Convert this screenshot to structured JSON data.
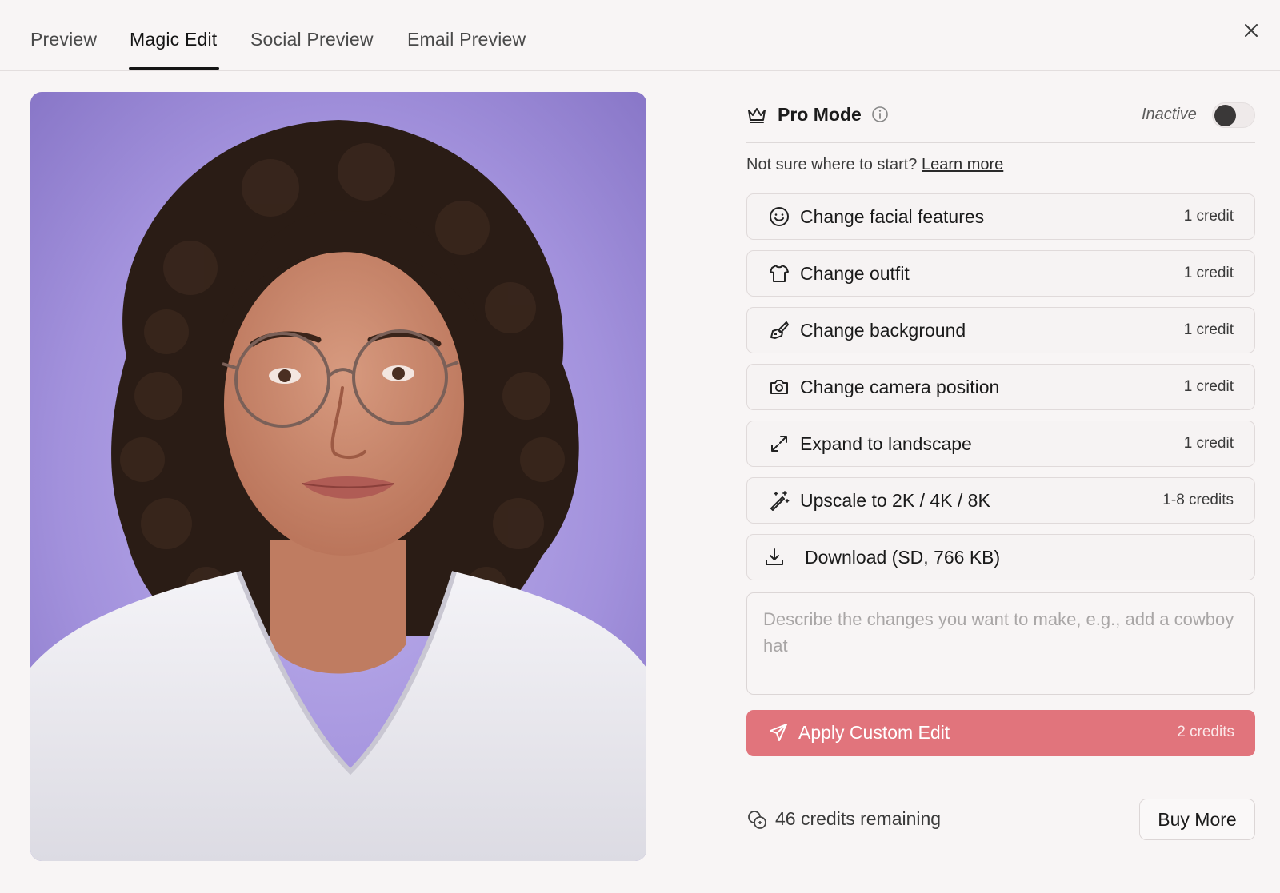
{
  "tabs": [
    {
      "label": "Preview",
      "active": false
    },
    {
      "label": "Magic Edit",
      "active": true
    },
    {
      "label": "Social Preview",
      "active": false
    },
    {
      "label": "Email Preview",
      "active": false
    }
  ],
  "pro_mode": {
    "label": "Pro Mode",
    "status": "Inactive",
    "enabled": false
  },
  "hint": {
    "text": "Not sure where to start?",
    "link": "Learn more"
  },
  "options": [
    {
      "icon": "smile-icon",
      "label": "Change facial features",
      "cost": "1 credit"
    },
    {
      "icon": "shirt-icon",
      "label": "Change outfit",
      "cost": "1 credit"
    },
    {
      "icon": "paintbrush-icon",
      "label": "Change background",
      "cost": "1 credit"
    },
    {
      "icon": "camera-icon",
      "label": "Change camera position",
      "cost": "1 credit"
    },
    {
      "icon": "expand-icon",
      "label": "Expand to landscape",
      "cost": "1 credit"
    },
    {
      "icon": "magic-wand-icon",
      "label": "Upscale to 2K / 4K / 8K",
      "cost": "1-8 credits"
    },
    {
      "icon": "download-icon",
      "label": "Download (SD, 766 KB)",
      "cost": ""
    }
  ],
  "prompt": {
    "placeholder": "Describe the changes you want to make, e.g., add a cowboy hat",
    "value": ""
  },
  "apply": {
    "label": "Apply Custom Edit",
    "cost": "2 credits"
  },
  "credits": {
    "remaining": "46 credits remaining",
    "buy_label": "Buy More"
  },
  "colors": {
    "accent": "#e1747c",
    "photo_background": "#9d8ad8"
  }
}
